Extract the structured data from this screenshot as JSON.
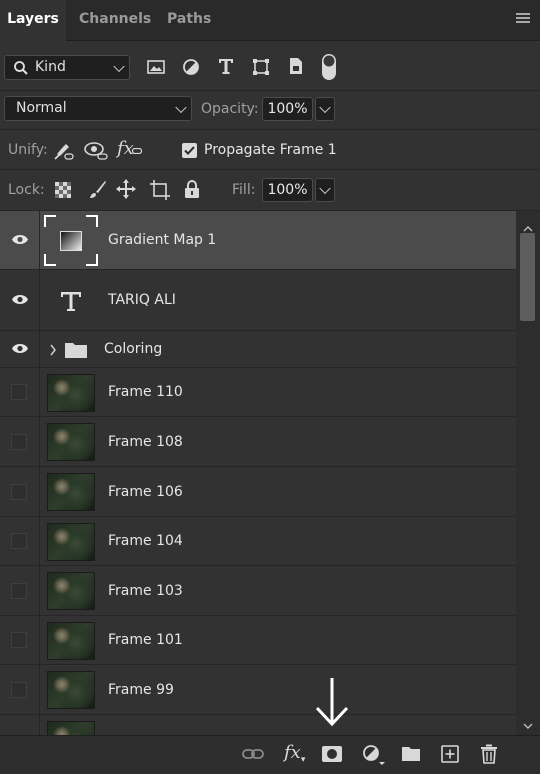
{
  "tabs": [
    {
      "label": "Layers",
      "active": true
    },
    {
      "label": "Channels",
      "active": false
    },
    {
      "label": "Paths",
      "active": false
    }
  ],
  "filter": {
    "kind_label": "Kind",
    "icons": [
      "image-filter-icon",
      "adjustment-filter-icon",
      "type-filter-icon",
      "shape-filter-icon",
      "smart-object-filter-icon",
      "filter-toggle-icon"
    ]
  },
  "blend": {
    "mode": "Normal",
    "opacity_label": "Opacity:",
    "opacity_value": "100%"
  },
  "unify": {
    "label": "Unify:",
    "propagate_label": "Propagate Frame 1",
    "propagate_checked": true
  },
  "lock": {
    "label": "Lock:",
    "fill_label": "Fill:",
    "fill_value": "100%"
  },
  "layers": [
    {
      "name": "Gradient Map 1",
      "type": "adjustment",
      "visible": true,
      "selected": true
    },
    {
      "name": "TARIQ ALI",
      "type": "text",
      "visible": true
    },
    {
      "name": "Coloring",
      "type": "group",
      "visible": true
    },
    {
      "name": "Frame 110",
      "type": "image",
      "visible": false
    },
    {
      "name": "Frame 108",
      "type": "image",
      "visible": false
    },
    {
      "name": "Frame 106",
      "type": "image",
      "visible": false
    },
    {
      "name": "Frame 104",
      "type": "image",
      "visible": false
    },
    {
      "name": "Frame 103",
      "type": "image",
      "visible": false
    },
    {
      "name": "Frame 101",
      "type": "image",
      "visible": false
    },
    {
      "name": "Frame 99",
      "type": "image",
      "visible": false
    }
  ],
  "bottom_icons": [
    "link-layers-icon",
    "fx-icon",
    "add-mask-icon",
    "adjustment-layer-icon",
    "new-group-icon",
    "new-layer-icon",
    "delete-layer-icon"
  ],
  "annotation": "down-arrow-annotation",
  "colors": {
    "panel_bg": "#323232",
    "selected_row": "#4b4b4b",
    "tab_bar": "#2a2a2a"
  }
}
